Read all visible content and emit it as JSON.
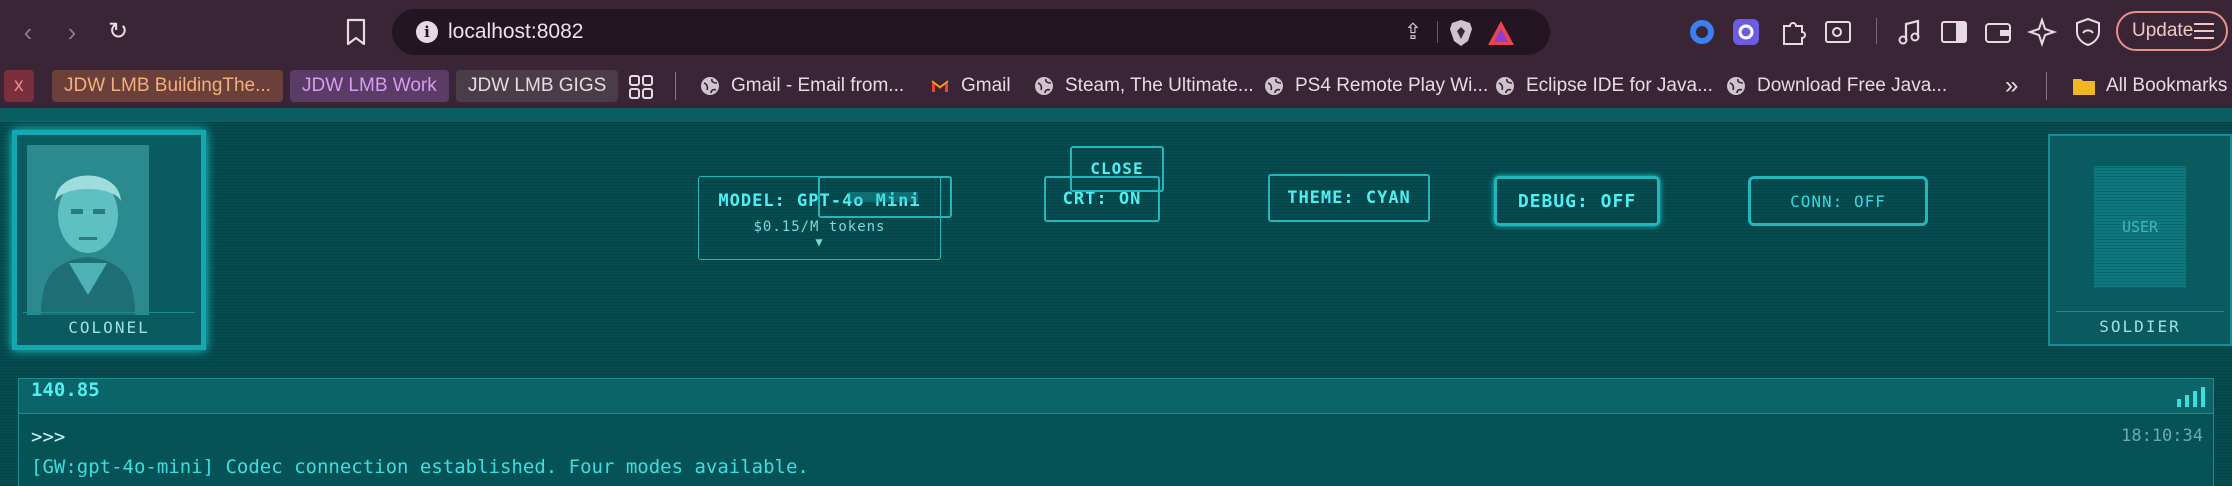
{
  "browser": {
    "url": "localhost:8082",
    "update_label": "Update",
    "bookmarks": [
      {
        "label": "x",
        "bg": "#7a2f3c",
        "color": "#f08c8c"
      },
      {
        "label": "JDW LMB BuildingThe...",
        "bg": "#6b3f3a",
        "color": "#f3b07a"
      },
      {
        "label": "JDW LMB Work",
        "bg": "#5a3c66",
        "color": "#d79bf0"
      },
      {
        "label": "JDW LMB GIGS",
        "bg": "#4a3d47",
        "color": "#e6dbe3"
      }
    ],
    "links": [
      {
        "label": "Gmail - Email from..."
      },
      {
        "label": "Gmail"
      },
      {
        "label": "Steam, The Ultimate..."
      },
      {
        "label": "PS4 Remote Play Wi..."
      },
      {
        "label": "Eclipse IDE for Java..."
      },
      {
        "label": "Download Free Java..."
      }
    ],
    "overflow_label": "»",
    "all_bookmarks_label": "All Bookmarks"
  },
  "app": {
    "left_portrait": {
      "caption": "COLONEL"
    },
    "right_portrait": {
      "caption": "SOLDIER",
      "placeholder": "USER"
    },
    "model": {
      "title": "MODEL: GPT-4o Mini",
      "price": "$0.15/M tokens",
      "arrow": "▼"
    },
    "close_label": "CLOSE",
    "crt_label": "CRT: ON",
    "theme_label": "THEME: CYAN",
    "debug_label": "DEBUG: OFF",
    "conn_label": "CONN: OFF",
    "frequency": "140.85",
    "console": {
      "prompt": ">>>",
      "time": "18:10:34",
      "log": "[GW:gpt-4o-mini] Codec connection established. Four modes available."
    }
  },
  "colors": {
    "accent": "#4ff0f2",
    "bg": "#054b4f"
  }
}
